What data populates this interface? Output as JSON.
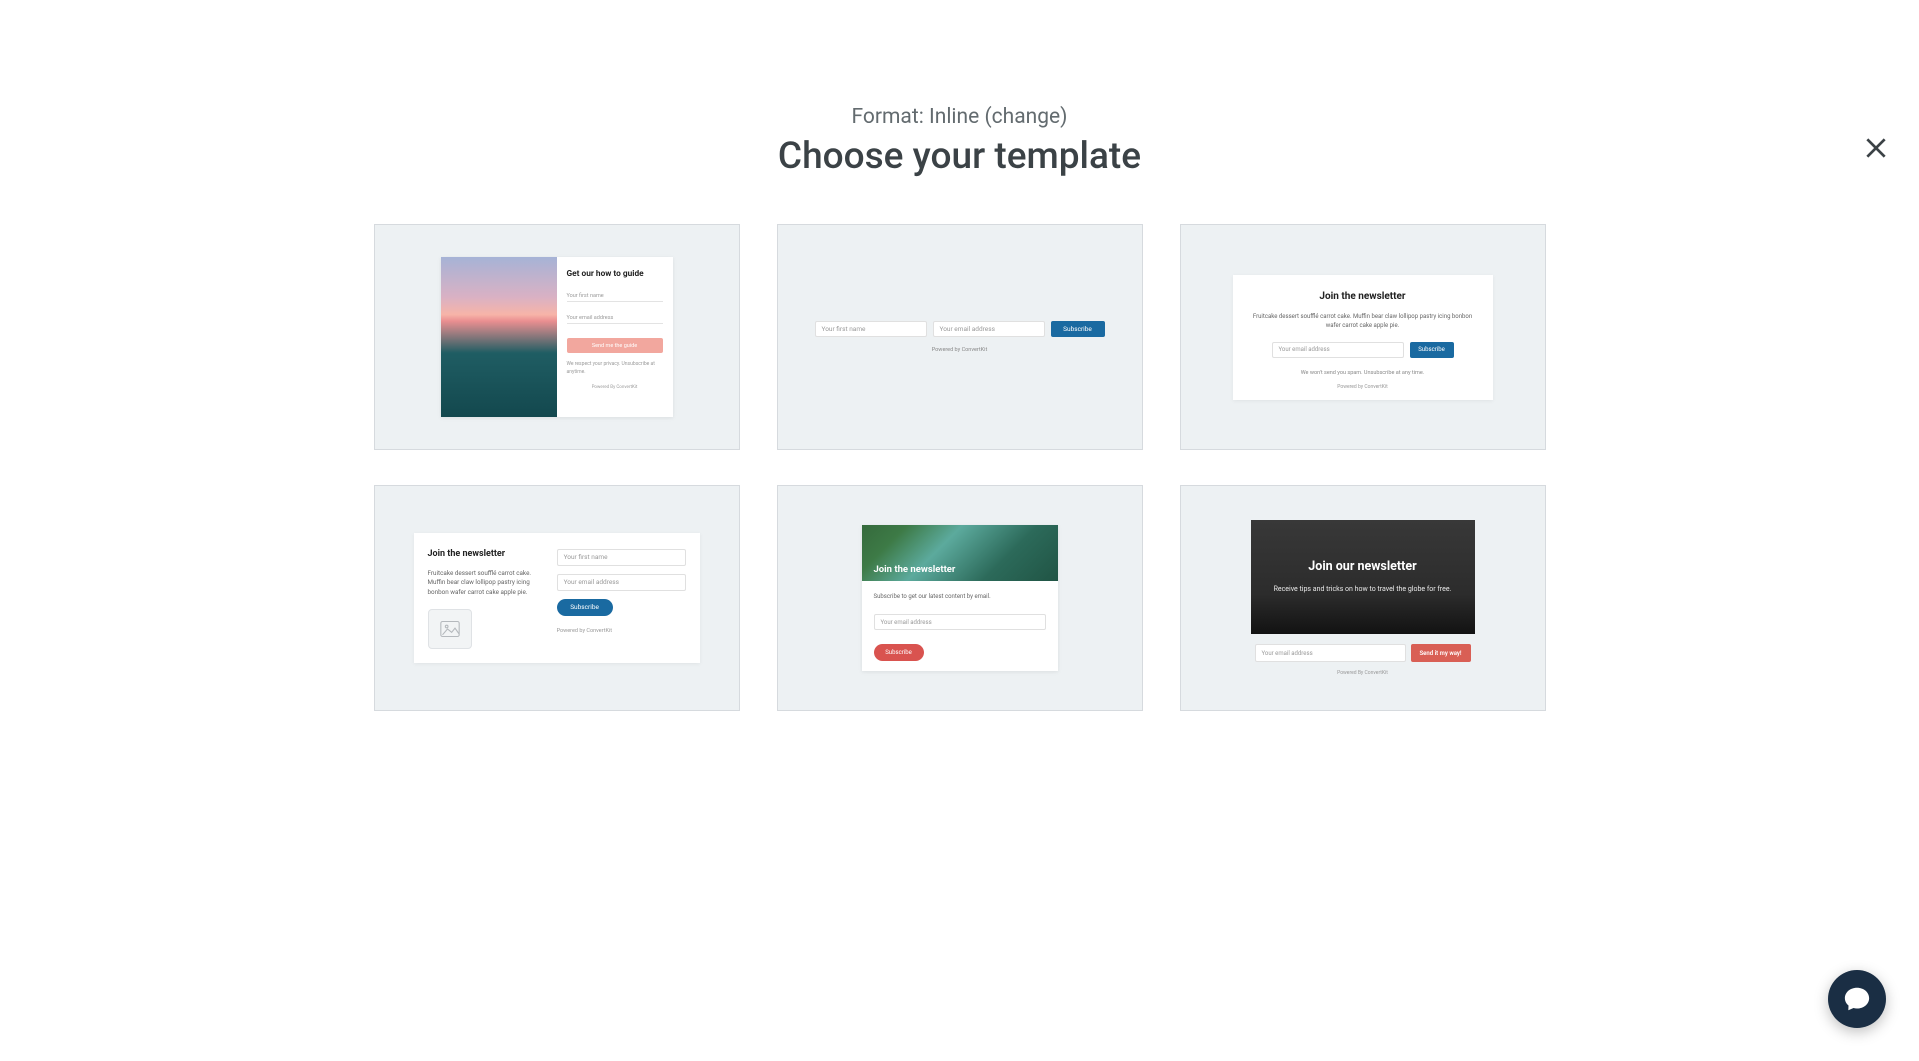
{
  "header": {
    "format_prefix": "Format: Inline ",
    "change_link": "(change)",
    "title": "Choose your template"
  },
  "templates": [
    {
      "id": "t1",
      "heading": "Get our how to guide",
      "input_firstname": "Your first name",
      "input_email": "Your email address",
      "button": "Send me the guide",
      "note": "We respect your privacy. Unsubscribe at anytime.",
      "powered_by": "Powered By ConvertKit"
    },
    {
      "id": "t2",
      "input_firstname": "Your first name",
      "input_email": "Your email address",
      "button": "Subscribe",
      "powered_by": "Powered by ConvertKit"
    },
    {
      "id": "t3",
      "heading": "Join the newsletter",
      "paragraph": "Fruitcake dessert soufflé carrot cake. Muffin bear claw lollipop pastry icing bonbon wafer carrot cake apple pie.",
      "input_email": "Your email address",
      "button": "Subscribe",
      "note": "We won't send you spam. Unsubscribe at any time.",
      "powered_by": "Powered by ConvertKit"
    },
    {
      "id": "t4",
      "heading": "Join the newsletter",
      "paragraph": "Fruitcake dessert soufflé carrot cake. Muffin bear claw lollipop pastry icing bonbon wafer carrot cake apple pie.",
      "input_firstname": "Your first name",
      "input_email": "Your email address",
      "button": "Subscribe",
      "powered_by": "Powered by ConvertKit"
    },
    {
      "id": "t5",
      "heading": "Join the newsletter",
      "paragraph": "Subscribe to get our latest content by email.",
      "input_email": "Your email address",
      "button": "Subscribe"
    },
    {
      "id": "t6",
      "heading": "Join our newsletter",
      "paragraph": "Receive tips and tricks on how to travel the globe for free.",
      "input_email": "Your email address",
      "button": "Send it my way!",
      "powered_by": "Powered By ConvertKit"
    }
  ]
}
